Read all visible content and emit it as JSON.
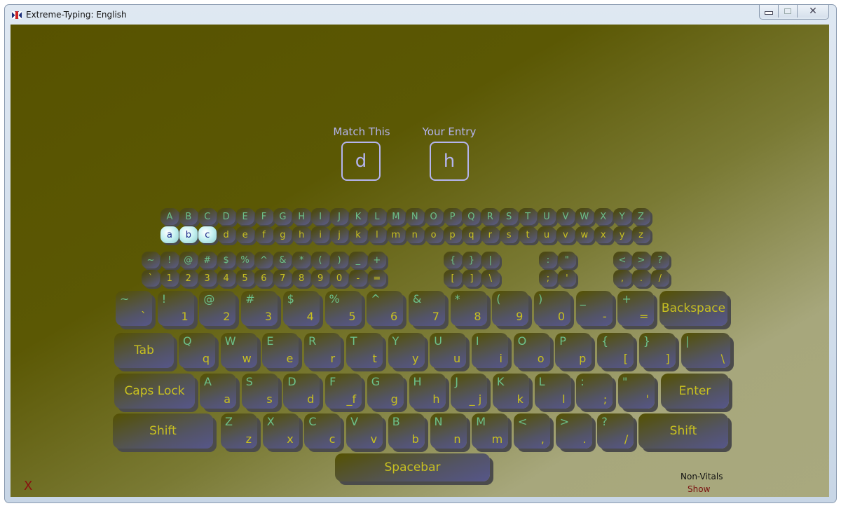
{
  "window": {
    "title": "Extreme-Typing: English",
    "controls": {
      "minimize": "minimize-icon",
      "maximize": "maximize-icon",
      "close": "close-icon"
    }
  },
  "prompt": {
    "match_label": "Match This",
    "match_char": "d",
    "entry_label": "Your Entry",
    "entry_char": "h"
  },
  "progress": {
    "upper": [
      "A",
      "B",
      "C",
      "D",
      "E",
      "F",
      "G",
      "H",
      "I",
      "J",
      "K",
      "L",
      "M",
      "N",
      "O",
      "P",
      "Q",
      "R",
      "S",
      "T",
      "U",
      "V",
      "W",
      "X",
      "Y",
      "Z"
    ],
    "lower": [
      "a",
      "b",
      "c",
      "d",
      "e",
      "f",
      "g",
      "h",
      "i",
      "j",
      "k",
      "l",
      "m",
      "n",
      "o",
      "p",
      "q",
      "r",
      "s",
      "t",
      "u",
      "v",
      "w",
      "x",
      "y",
      "z"
    ],
    "completed_lower": [
      "a",
      "b",
      "c"
    ],
    "symbols_upper": [
      "~",
      "!",
      "@",
      "#",
      "$",
      "%",
      "^",
      "&",
      "*",
      "(",
      ")",
      "_",
      "+"
    ],
    "symbols_lower": [
      "`",
      "1",
      "2",
      "3",
      "4",
      "5",
      "6",
      "7",
      "8",
      "9",
      "0",
      "-",
      "="
    ],
    "brackets_upper": [
      "{",
      "}",
      "|"
    ],
    "brackets_lower": [
      "[",
      "]",
      "\\"
    ],
    "colon_upper": [
      ":",
      "\""
    ],
    "colon_lower": [
      ";",
      "'"
    ],
    "angle_upper": [
      "<",
      ">",
      "?"
    ],
    "angle_lower": [
      ",",
      ".",
      "/"
    ]
  },
  "keyboard": {
    "row1": [
      {
        "up": "~",
        "lo": "`"
      },
      {
        "up": "!",
        "lo": "1"
      },
      {
        "up": "@",
        "lo": "2"
      },
      {
        "up": "#",
        "lo": "3"
      },
      {
        "up": "$",
        "lo": "4"
      },
      {
        "up": "%",
        "lo": "5"
      },
      {
        "up": "^",
        "lo": "6"
      },
      {
        "up": "&",
        "lo": "7"
      },
      {
        "up": "*",
        "lo": "8"
      },
      {
        "up": "(",
        "lo": "9"
      },
      {
        "up": ")",
        "lo": "0"
      },
      {
        "up": "_",
        "lo": "-"
      },
      {
        "up": "+",
        "lo": "="
      }
    ],
    "backspace": "Backspace",
    "tab": "Tab",
    "row2": [
      {
        "up": "Q",
        "lo": "q"
      },
      {
        "up": "W",
        "lo": "w"
      },
      {
        "up": "E",
        "lo": "e"
      },
      {
        "up": "R",
        "lo": "r"
      },
      {
        "up": "T",
        "lo": "t"
      },
      {
        "up": "Y",
        "lo": "y"
      },
      {
        "up": "U",
        "lo": "u"
      },
      {
        "up": "I",
        "lo": "i"
      },
      {
        "up": "O",
        "lo": "o"
      },
      {
        "up": "P",
        "lo": "p"
      },
      {
        "up": "{",
        "lo": "["
      },
      {
        "up": "}",
        "lo": "]"
      }
    ],
    "pipe_key": {
      "up": "|",
      "lo": "\\"
    },
    "caps": "Caps Lock",
    "row3": [
      {
        "up": "A",
        "lo": "a"
      },
      {
        "up": "S",
        "lo": "s"
      },
      {
        "up": "D",
        "lo": "d"
      },
      {
        "up": "F",
        "lo": "_f"
      },
      {
        "up": "G",
        "lo": "g"
      },
      {
        "up": "H",
        "lo": "h"
      },
      {
        "up": "J",
        "lo": "_ j"
      },
      {
        "up": "K",
        "lo": "k"
      },
      {
        "up": "L",
        "lo": "l"
      },
      {
        "up": ":",
        "lo": ";"
      },
      {
        "up": "\"",
        "lo": "'"
      }
    ],
    "enter": "Enter",
    "shift_left": "Shift",
    "row4": [
      {
        "up": "Z",
        "lo": "z"
      },
      {
        "up": "X",
        "lo": "x"
      },
      {
        "up": "C",
        "lo": "c"
      },
      {
        "up": "V",
        "lo": "v"
      },
      {
        "up": "B",
        "lo": "b"
      },
      {
        "up": "N",
        "lo": "n"
      },
      {
        "up": "M",
        "lo": "m"
      },
      {
        "up": "<",
        "lo": ","
      },
      {
        "up": ">",
        "lo": "."
      },
      {
        "up": "?",
        "lo": "/"
      }
    ],
    "shift_right": "Shift",
    "spacebar": "Spacebar"
  },
  "footer": {
    "exit": "X",
    "nonvitals_label": "Non-Vitals",
    "show_link": "Show"
  }
}
